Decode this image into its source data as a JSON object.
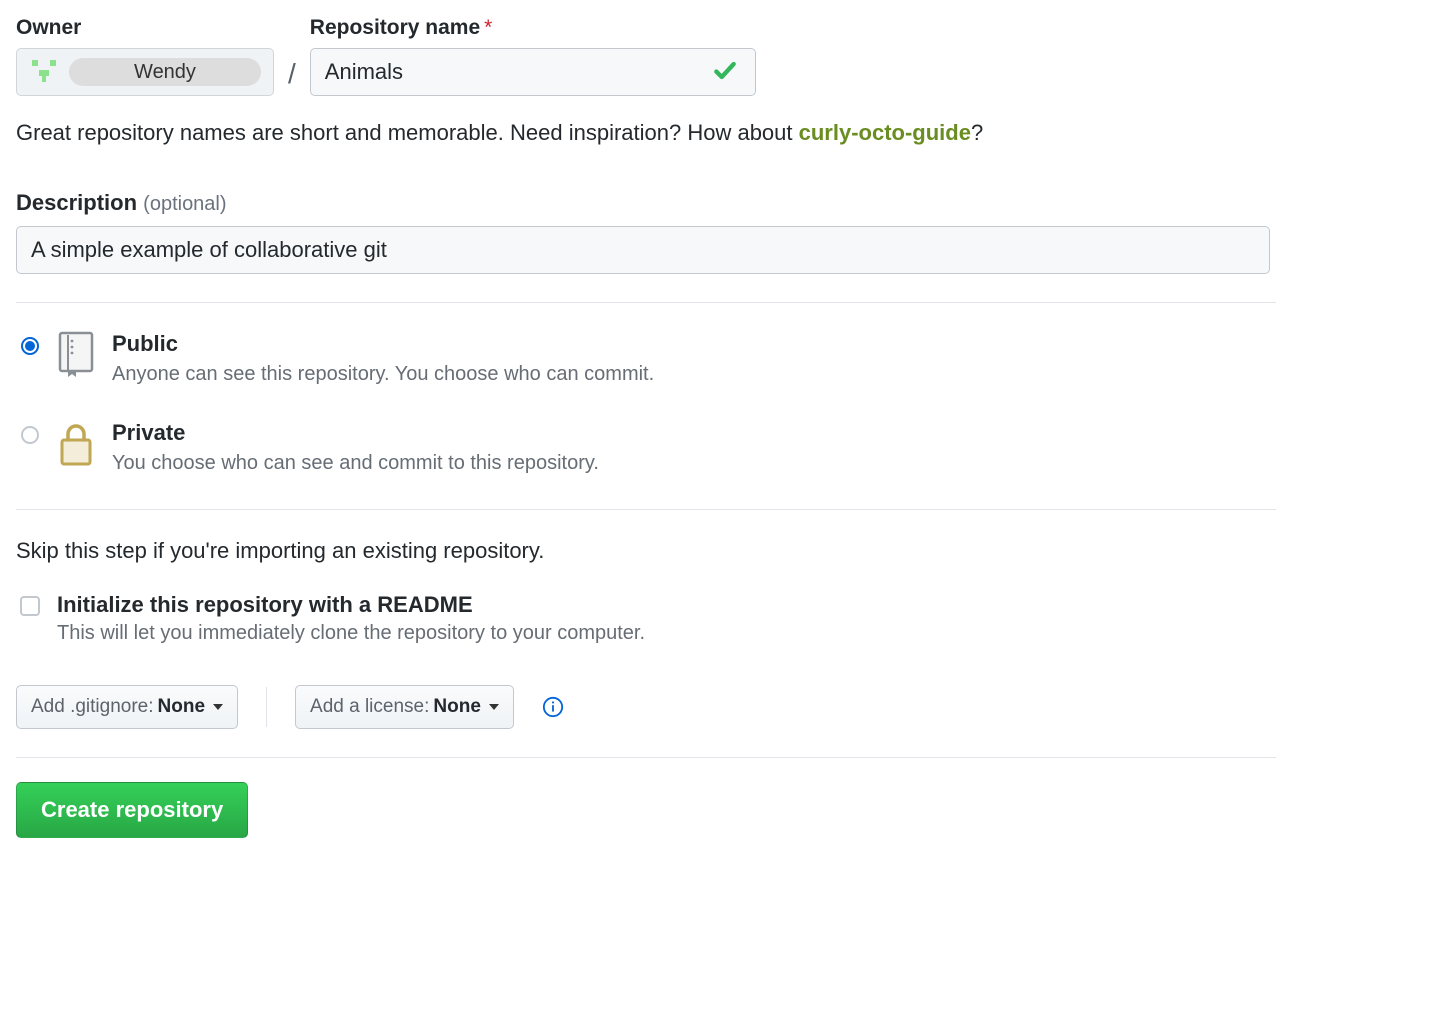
{
  "form": {
    "owner_label": "Owner",
    "owner_name": "Wendy",
    "slash": "/",
    "repo_label": "Repository name",
    "required_mark": "*",
    "repo_value": "Animals",
    "hint_prefix": "Great repository names are short and memorable. Need inspiration? How about ",
    "suggested_name": "curly-octo-guide",
    "hint_suffix": "?",
    "description_label": "Description",
    "optional_text": "(optional)",
    "description_value": "A simple example of collaborative git"
  },
  "visibility": {
    "public": {
      "title": "Public",
      "desc": "Anyone can see this repository. You choose who can commit."
    },
    "private": {
      "title": "Private",
      "desc": "You choose who can see and commit to this repository."
    }
  },
  "init": {
    "skip_text": "Skip this step if you're importing an existing repository.",
    "readme_title": "Initialize this repository with a README",
    "readme_desc": "This will let you immediately clone the repository to your computer."
  },
  "dropdowns": {
    "gitignore_prefix": "Add .gitignore: ",
    "gitignore_value": "None",
    "license_prefix": "Add a license: ",
    "license_value": "None"
  },
  "submit": {
    "label": "Create repository"
  }
}
